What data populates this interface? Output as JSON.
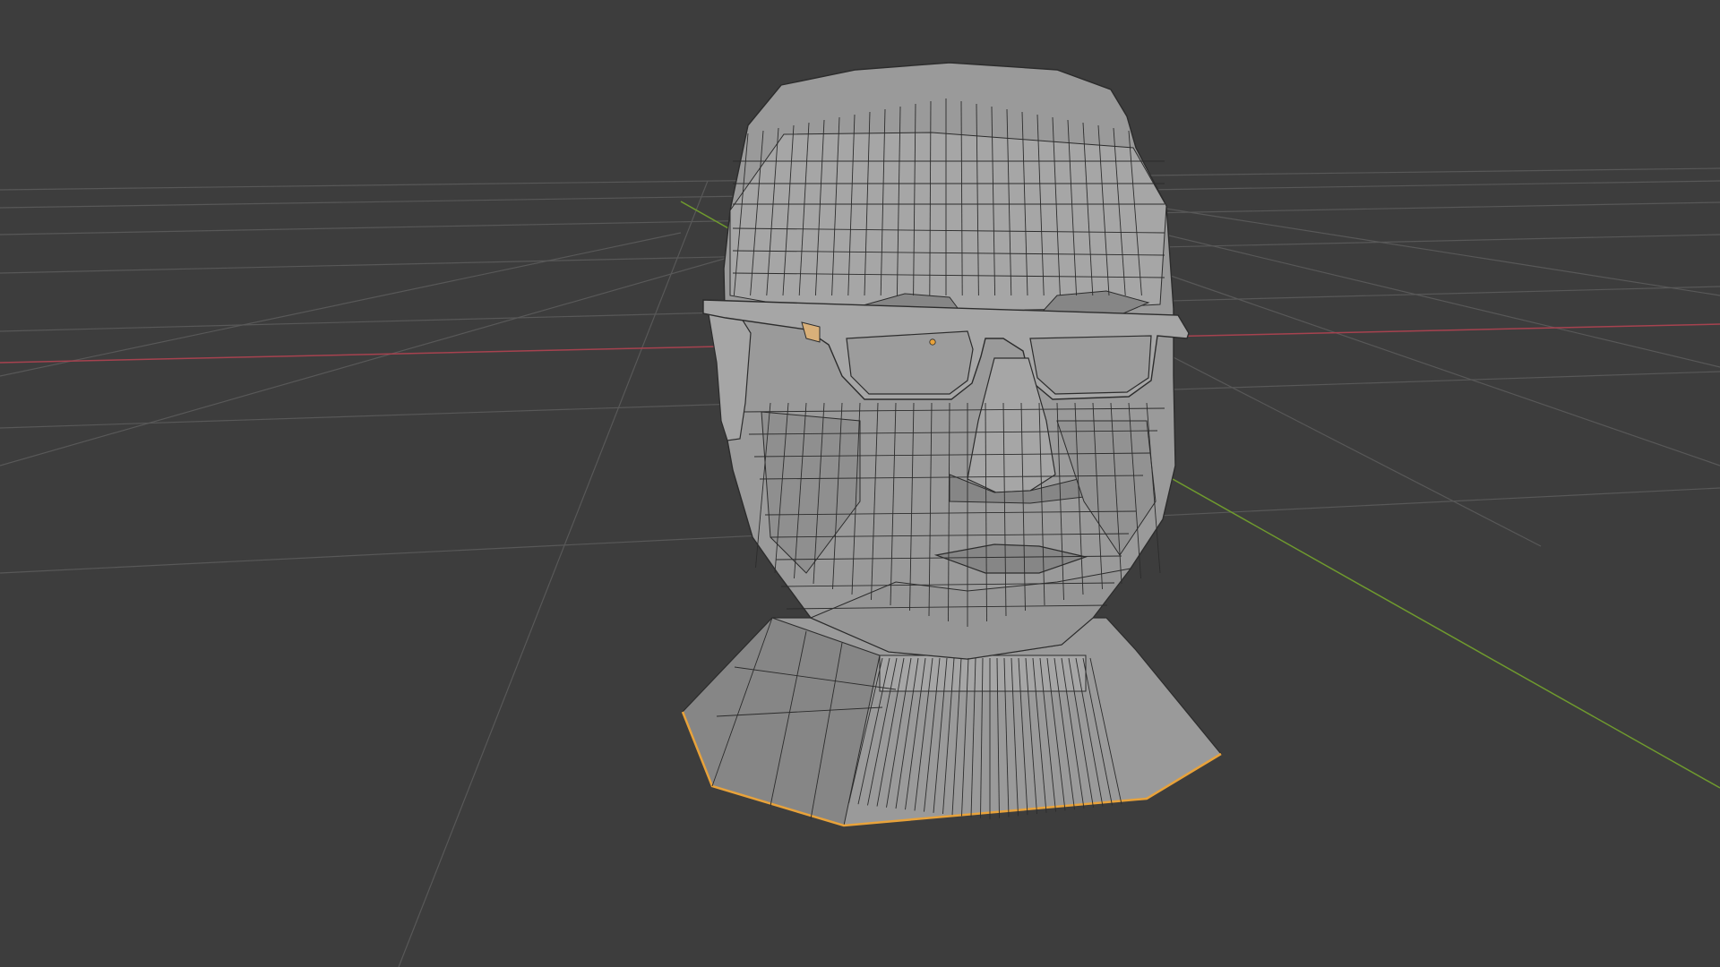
{
  "viewport": {
    "background": "#3d3d3d",
    "grid_color": "#585858",
    "x_axis_color": "#a6424f",
    "y_axis_color": "#6f9a2e"
  },
  "object": {
    "mesh_fill": "#9a9a9a",
    "mesh_shade": "#868686",
    "mesh_light": "#a6a6a6",
    "wire_color": "#2c2c2c",
    "selection_outline_color": "#e8a23a",
    "origin_color": "#e8a23a"
  }
}
